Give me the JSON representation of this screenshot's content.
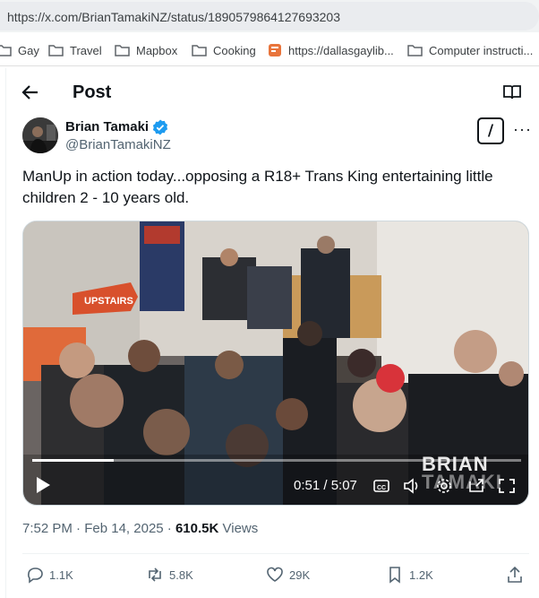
{
  "browser": {
    "url": "https://x.com/BrianTamakiNZ/status/1890579864127693203",
    "bookmarks": [
      {
        "label": "Gay",
        "icon": "folder-icon"
      },
      {
        "label": "Travel",
        "icon": "folder-icon"
      },
      {
        "label": "Mapbox",
        "icon": "folder-icon"
      },
      {
        "label": "Cooking",
        "icon": "folder-icon"
      },
      {
        "label": "https://dallasgaylib...",
        "icon": "rss-icon"
      },
      {
        "label": "Computer instructi...",
        "icon": "folder-icon"
      }
    ]
  },
  "header": {
    "title": "Post"
  },
  "author": {
    "name": "Brian Tamaki",
    "handle": "@BrianTamakiNZ",
    "verified": true
  },
  "tweet": {
    "text": "ManUp in action today...opposing a R18+ Trans King entertaining little children 2 - 10 years old."
  },
  "video": {
    "time": "0:51 / 5:07",
    "progress": 0.166,
    "watermark_line1": "BRIAN",
    "watermark_line2": "TAMAKI",
    "sign_text": "UPSTAIRS"
  },
  "meta": {
    "time": "7:52 PM",
    "date": "Feb 14, 2025",
    "views_count": "610.5K",
    "views_label": "Views"
  },
  "actions": {
    "replies": "1.1K",
    "reposts": "5.8K",
    "likes": "29K",
    "bookmarks": "1.2K"
  },
  "colors": {
    "accent": "#1d9bf0",
    "text": "#0f1419",
    "secondary": "#536471"
  }
}
